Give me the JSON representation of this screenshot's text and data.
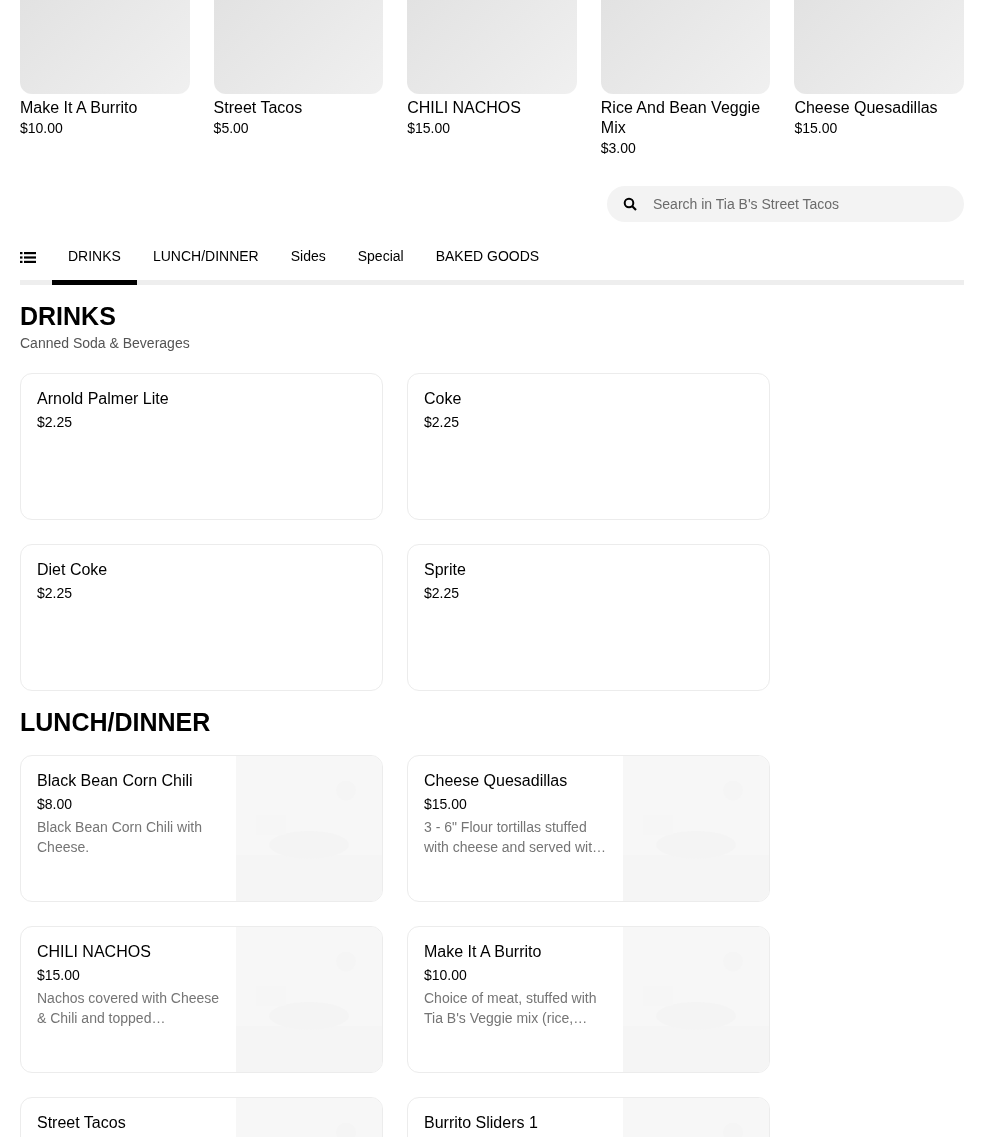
{
  "featured": [
    {
      "name": "Make It A Burrito",
      "price": "$10.00"
    },
    {
      "name": "Street Tacos",
      "price": "$5.00"
    },
    {
      "name": "CHILI NACHOS",
      "price": "$15.00"
    },
    {
      "name": "Rice And Bean Veggie Mix",
      "price": "$3.00"
    },
    {
      "name": "Cheese Quesadillas",
      "price": "$15.00"
    }
  ],
  "search": {
    "placeholder": "Search in Tia B's Street Tacos"
  },
  "tabs": [
    {
      "label": "DRINKS",
      "selected": true
    },
    {
      "label": "LUNCH/DINNER",
      "selected": false
    },
    {
      "label": "Sides",
      "selected": false
    },
    {
      "label": "Special",
      "selected": false
    },
    {
      "label": "BAKED GOODS",
      "selected": false
    }
  ],
  "sections": [
    {
      "title": "DRINKS",
      "subtitle": "Canned Soda & Beverages",
      "items": [
        {
          "name": "Arnold Palmer Lite",
          "price": "$2.25"
        },
        {
          "name": "Coke",
          "price": "$2.25"
        },
        {
          "name": "Diet Coke",
          "price": "$2.25"
        },
        {
          "name": "Sprite",
          "price": "$2.25"
        }
      ]
    },
    {
      "title": "LUNCH/DINNER",
      "items": [
        {
          "name": "Black Bean Corn Chili",
          "price": "$8.00",
          "description": "Black Bean Corn Chili with Cheese.",
          "kind": "picture"
        },
        {
          "name": "Cheese Quesadillas",
          "price": "$15.00",
          "description": "3 - 6\" Flour tortillas stuffed with cheese and served wit…",
          "kind": "picture"
        },
        {
          "name": "CHILI NACHOS",
          "price": "$15.00",
          "description": "Nachos covered with Cheese & Chili and topped…",
          "kind": "picture"
        },
        {
          "name": "Make It A Burrito",
          "price": "$10.00",
          "description": "Choice of meat, stuffed with Tia B's Veggie mix (rice,…",
          "kind": "picture"
        },
        {
          "name": "Street Tacos",
          "kind": "picture"
        },
        {
          "name": "Burrito Sliders 1",
          "kind": "picture"
        }
      ]
    }
  ]
}
